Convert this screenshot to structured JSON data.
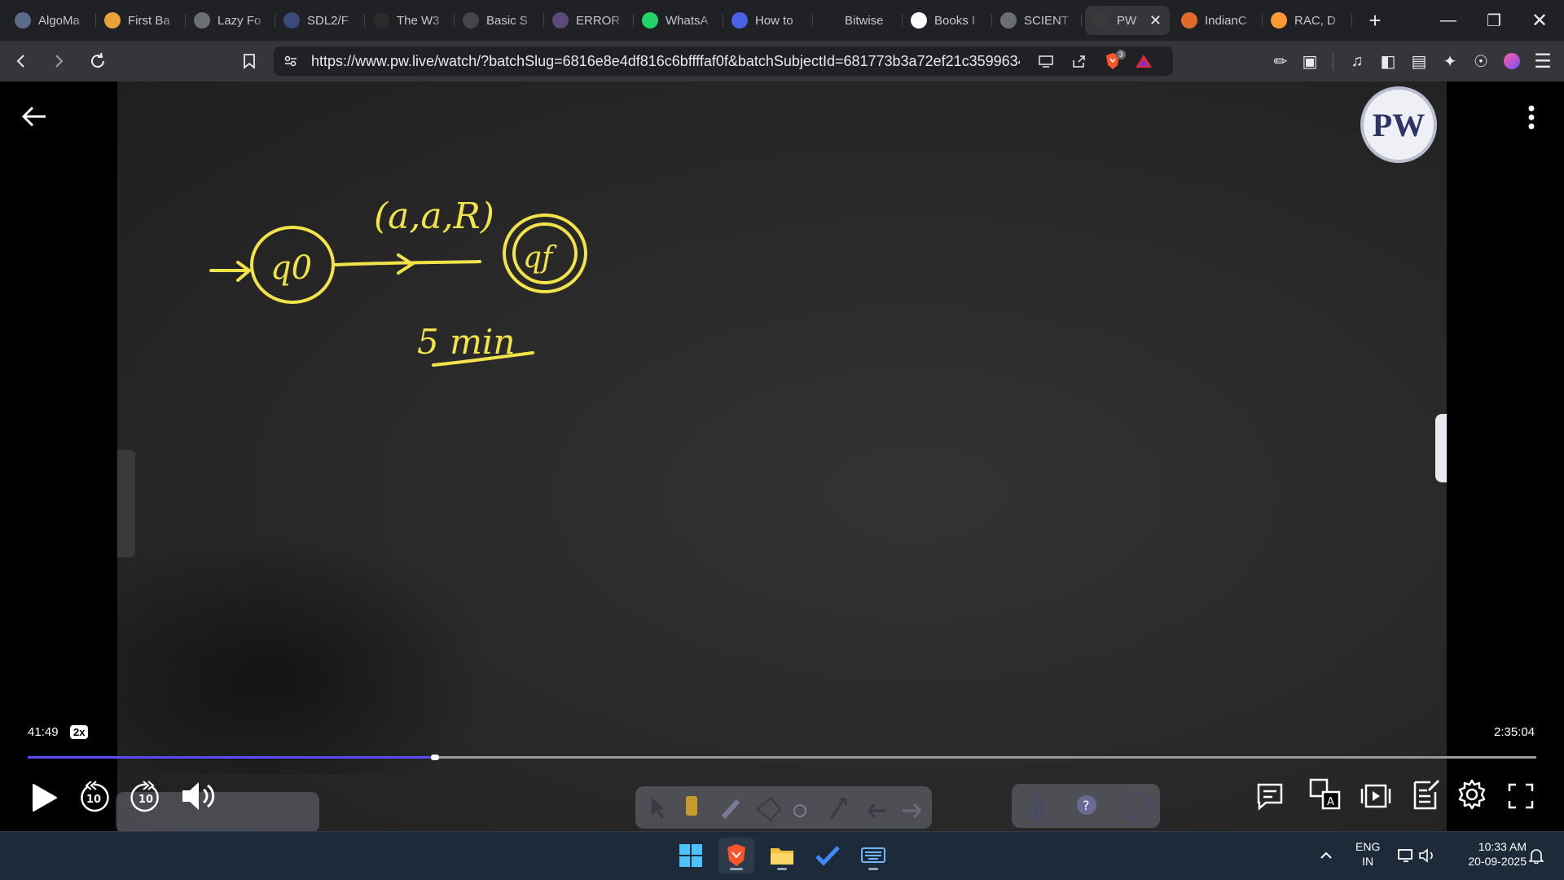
{
  "browser": {
    "tabs": [
      {
        "title": "AlgoMa",
        "icon": "chat-icon",
        "color": "#5b6b8a"
      },
      {
        "title": "First Ba",
        "icon": "stack-icon",
        "color": "#e8a23a"
      },
      {
        "title": "Lazy Fo",
        "icon": "globe-icon",
        "color": "#6b6e73"
      },
      {
        "title": "SDL2/F",
        "icon": "sdl-icon",
        "color": "#394a7a"
      },
      {
        "title": "The W3",
        "icon": "w3-icon",
        "color": "#2b2b2b"
      },
      {
        "title": "Basic S",
        "icon": "md-icon",
        "color": "#44464b"
      },
      {
        "title": "ERROR",
        "icon": "error-icon",
        "color": "#5b4a7a"
      },
      {
        "title": "WhatsA",
        "icon": "whatsapp-icon",
        "color": "#25d366"
      },
      {
        "title": "How to",
        "icon": "bookmark-icon",
        "color": "#4a62e8"
      },
      {
        "title": "Bitwise",
        "icon": "code-icon",
        "color": "#202124"
      },
      {
        "title": "Books I",
        "icon": "google-icon",
        "color": "#ffffff"
      },
      {
        "title": "SCIENT",
        "icon": "globe-icon",
        "color": "#6b6e73"
      },
      {
        "title": "PW",
        "icon": "pw-icon",
        "color": "#3a3a3a",
        "active": true
      },
      {
        "title": "IndianC",
        "icon": "indian-icon",
        "color": "#e06a2a"
      },
      {
        "title": "RAC, D",
        "icon": "flag-india-icon",
        "color": "#ff9933"
      }
    ],
    "url": "https://www.pw.live/watch/?batchSlug=6816e8e4df816c6bffffaf0f&batchSubjectId=681773b3a72ef21c3599634...",
    "brave_badge": "3"
  },
  "player": {
    "current_time": "41:49",
    "speed": "2x",
    "duration": "2:35:04",
    "progress": 0.27,
    "skip_back": "10",
    "skip_forward": "10",
    "board_labels": {
      "edge_label": "(a,a,R)",
      "start_state": "q0",
      "final_state": "qf",
      "note": "5 min"
    },
    "logo_text": "PW"
  },
  "taskbar": {
    "lang_top": "ENG",
    "lang_bottom": "IN",
    "time": "10:33 AM",
    "date": "20-09-2025"
  }
}
